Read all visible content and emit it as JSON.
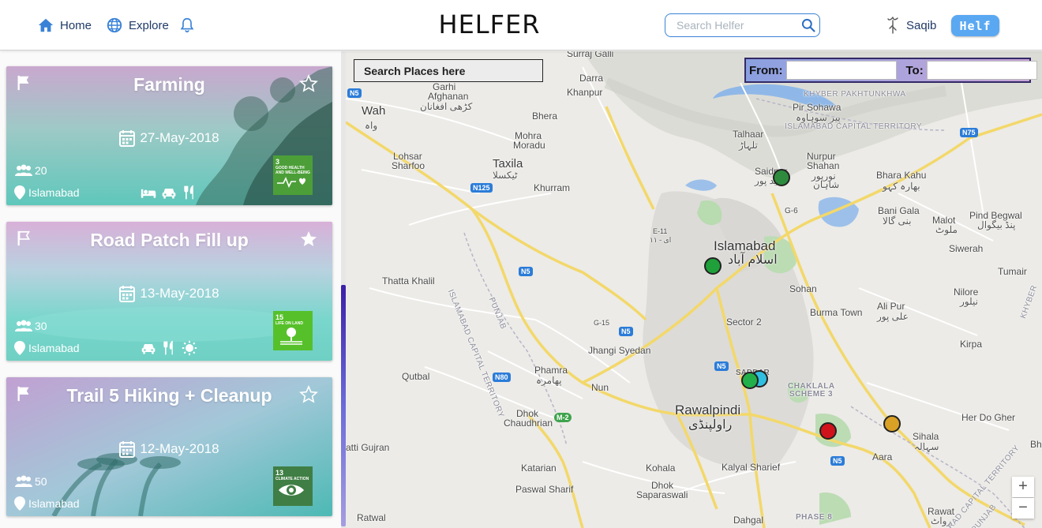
{
  "nav": {
    "home": "Home",
    "explore": "Explore",
    "brand": "HELFER",
    "search_placeholder": "Search Helfer",
    "user_name": "Saqib",
    "helf_button": "Helf"
  },
  "cards": [
    {
      "title": "Farming",
      "date": "27-May-2018",
      "volunteers": "20",
      "location": "Islamabad",
      "starred": false,
      "flag_filled": true,
      "amenities": [
        "bed-icon",
        "car-icon",
        "utensils-icon"
      ],
      "sdg": {
        "number": "3",
        "label": "GOOD HEALTH AND WELL-BEING",
        "color": "#4c9f38"
      }
    },
    {
      "title": "Road Patch Fill up",
      "date": "13-May-2018",
      "volunteers": "30",
      "location": "Islamabad",
      "starred": true,
      "flag_filled": false,
      "amenities": [
        "car-icon",
        "utensils-icon",
        "sun-icon"
      ],
      "sdg": {
        "number": "15",
        "label": "LIFE ON LAND",
        "color": "#56c02b"
      }
    },
    {
      "title": "Trail 5 Hiking + Cleanup",
      "date": "12-May-2018",
      "volunteers": "50",
      "location": "Islamabad",
      "starred": false,
      "flag_filled": true,
      "amenities": [],
      "sdg": {
        "number": "13",
        "label": "CLIMATE ACTION",
        "color": "#3f7e44"
      }
    }
  ],
  "map": {
    "place_search_placeholder": "Search Places here",
    "from_label": "From:",
    "to_label": "To:",
    "zoom_in": "+",
    "zoom_out": "−",
    "labels": {
      "surraj_galli": "Surraj Galli",
      "darra": "Darra",
      "garhi_afghanan": "Garhi",
      "garhi_afghanan2": "Afghanan",
      "garhi_ur": "کڑھی افغانان",
      "khanpur": "Khanpur",
      "wah": "Wah",
      "wah_ur": "واہ",
      "bhera": "Bhera",
      "mohra_moradu": "Mohra",
      "mohra_moradu2": "Moradu",
      "taxila": "Taxila",
      "taxila_ur": "ٹیکسلا",
      "lohsar": "Lohsar",
      "sharfoo": "Sharfoo",
      "khurram": "Khurram",
      "kp": "KHYBER PAKHTUNKHWA",
      "pir_sohawa": "Pir Sohawa",
      "pir_sohawa_ur": "پیر سوہاوہ",
      "ict": "ISLAMABAD CAPITAL TERRITORY",
      "talhaar": "Talhaar",
      "talhaar_ur": "تلہاڑ",
      "nurpur": "Nurpur",
      "shahan": "Shahan",
      "nurpur_ur": "نورپور",
      "nurpur_ur2": "شاہان",
      "saidpur": "Saidpur",
      "saidpur_ur": "سید پور",
      "bhara_kahu": "Bhara Kahu",
      "bhara_kahu_ur": "بھارہ کہو",
      "bani_gala": "Bani Gala",
      "bani_gala_ur": "بنی گالا",
      "malot": "Malot",
      "malot_ur": "ملوٹ",
      "pind_begwal": "Pind Begwal",
      "pind_begwal_ur": "پنڈ بیگوال",
      "e11": "E-11",
      "e11_ur": "ای - ۱۱",
      "g6": "G-6",
      "islamabad": "Islamabad",
      "islamabad_ur": "اسلام آباد",
      "siwerah": "Siwerah",
      "thatta_khalil": "Thatta Khalil",
      "sohan": "Sohan",
      "tumair": "Tumair",
      "nilore": "Nilore",
      "nilore_ur": "نیلور",
      "ali_pur": "Ali Pur",
      "ali_pur_ur": "علی پور",
      "burma_town": "Burma Town",
      "sector2": "Sector 2",
      "g15": "G-15",
      "kirpa": "Kirpa",
      "jhangi_syedan": "Jhangi Syedan",
      "saddar": "SADDAR",
      "chaklala": "CHAKLALA",
      "scheme3": "SCHEME 3",
      "qutbal": "Qutbal",
      "phamra": "Phamra",
      "phamra_ur": "پھامرہ",
      "nun": "Nun",
      "rawalpindi": "Rawalpindi",
      "rawalpindi_ur": "راولپنڈی",
      "her_do_gher": "Her Do Gher",
      "sihala": "Sihala",
      "sihala_ur": "سہالہ",
      "dhok_chaudhrian": "Dhok",
      "dhok_chaudhrian2": "Chaudhrian",
      "aara": "Aara",
      "atti_gujran": "atti Gujran",
      "katarian": "Katarian",
      "kohala": "Kohala",
      "kalyal_sharief": "Kalyal Sharief",
      "dhok_saparaswali": "Dhok",
      "dhok_saparaswali2": "Saparaswali",
      "paswal_sharif": "Paswal Sharif",
      "phase8": "PHASE 8",
      "ratwal": "Ratwal",
      "dahgal": "Dahgal",
      "rawat": "Rawat",
      "rawat_ur": "رواٹ",
      "bh": "Bh",
      "ict_punjab_w": "ISLAMABAD CAPITAL TERRITORY",
      "punjab_w": "PUNJAB",
      "ict_punjab_e": "RAD CAPITAL TERRITORY",
      "punjab_e": "PUNJAB",
      "kp_edge": "KHYBER"
    },
    "shields": {
      "n5a": "N5",
      "n125": "N125",
      "n5b": "N5",
      "n5c": "N5",
      "n5d": "N5",
      "n5e": "N5",
      "n80": "N80",
      "m2": "M-2",
      "n75": "N75"
    },
    "markers": [
      {
        "color": "#2e8b3e"
      },
      {
        "color": "#1fa03a"
      },
      {
        "color": "#2fbfe0"
      },
      {
        "color": "#22b04a"
      },
      {
        "color": "#d0121b"
      },
      {
        "color": "#d9a126"
      }
    ]
  }
}
